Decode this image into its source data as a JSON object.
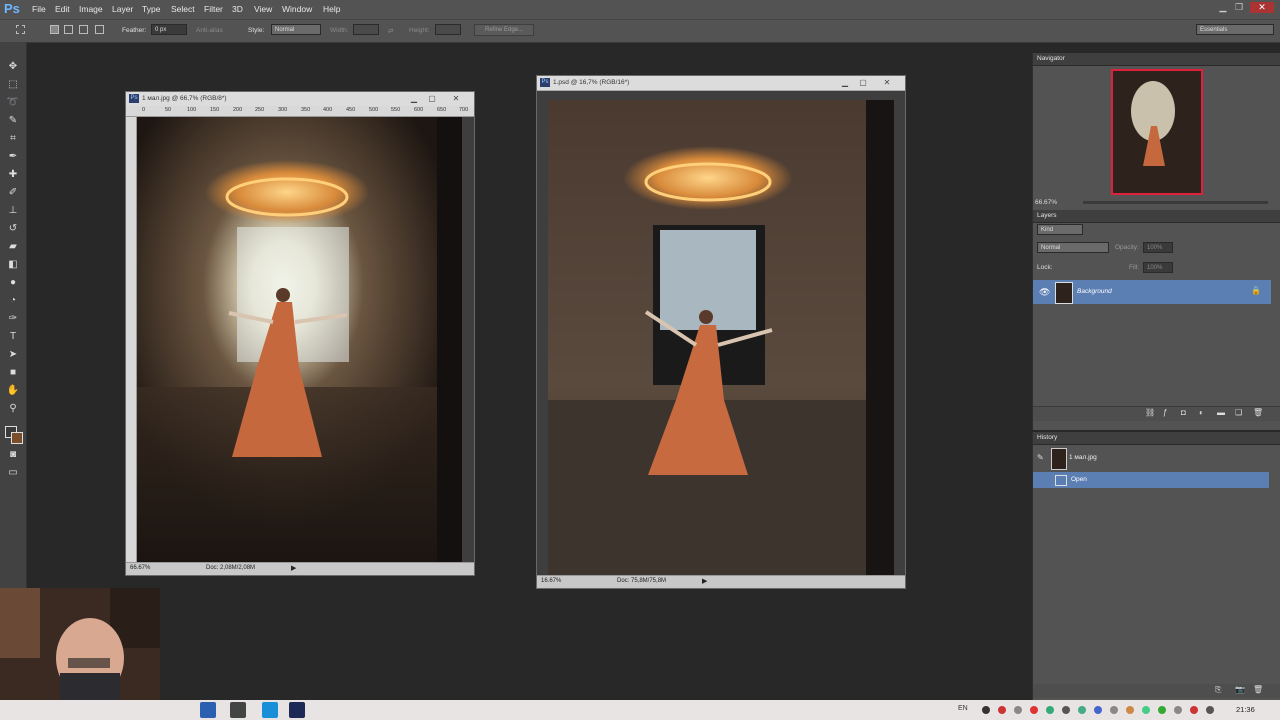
{
  "app": {
    "logo": "Ps"
  },
  "menu": [
    "File",
    "Edit",
    "Image",
    "Layer",
    "Type",
    "Select",
    "Filter",
    "3D",
    "View",
    "Window",
    "Help"
  ],
  "options": {
    "feather_label": "Feather:",
    "feather_value": "0 px",
    "antialias_label": "Anti-alias",
    "style_label": "Style:",
    "style_value": "Normal",
    "width_label": "Width:",
    "height_label": "Height:",
    "refine_edge": "Refine Edge...",
    "workspace": "Essentials"
  },
  "doc1": {
    "title": "1 мал.jpg @ 66,7% (RGB/8*)",
    "zoom": "66.67%",
    "doc_size": "Doc: 2,08M/2,08M",
    "ruler": [
      "0",
      "50",
      "100",
      "150",
      "200",
      "250",
      "300",
      "350",
      "400",
      "450",
      "500",
      "550",
      "600",
      "650",
      "700"
    ]
  },
  "doc2": {
    "title": "1.psd @ 16,7% (RGB/16*)",
    "zoom": "16.67%",
    "doc_size": "Doc: 75,8M/75,8M"
  },
  "navigator": {
    "title": "Navigator",
    "zoom": "66.67%"
  },
  "layers": {
    "title": "Layers",
    "kind": "Kind",
    "blend": "Normal",
    "opacity_label": "Opacity:",
    "opacity_value": "100%",
    "lock_label": "Lock:",
    "fill_label": "Fill:",
    "fill_value": "100%",
    "items": [
      {
        "name": "Background"
      }
    ]
  },
  "history": {
    "title": "History",
    "snapshot": "1 мал.jpg",
    "items": [
      {
        "name": "Open"
      }
    ]
  },
  "taskbar": {
    "lang": "EN",
    "time": "21:36"
  },
  "colors": {
    "menubar": "#535353",
    "panel": "#535353",
    "workspace": "#282828",
    "selection": "#5b7eb3",
    "navigator_box": "#e0203a"
  }
}
